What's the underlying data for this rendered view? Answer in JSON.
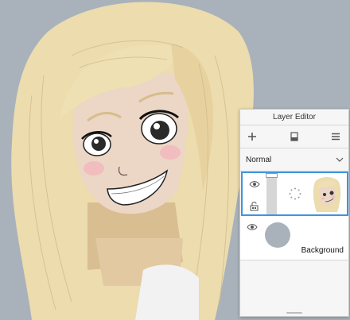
{
  "panel": {
    "title": "Layer Editor",
    "blend_mode": "Normal",
    "toolbar": {
      "add_icon": "plus-icon",
      "layer_icon": "layer-stack-icon",
      "menu_icon": "hamburger-menu-icon"
    }
  },
  "layers": [
    {
      "name": "",
      "visible": true,
      "locked": false,
      "selected": true,
      "thumbnail": "girl-sketch"
    },
    {
      "name": "Background",
      "visible": true,
      "selected": false,
      "color": "#a9b2bb"
    }
  ],
  "colors": {
    "accent": "#3d95e0",
    "canvas_bg": "#a9b2bb",
    "hair": "#ecdcae",
    "skin": "#ecd6c6"
  }
}
